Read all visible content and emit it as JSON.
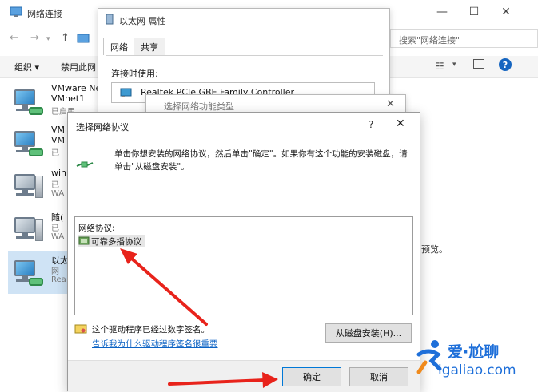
{
  "explorer": {
    "title": "网络连接",
    "window_controls": [
      "—",
      "☐",
      "✕"
    ],
    "nav": {
      "back": "←",
      "forward": "→",
      "up": "↑"
    },
    "search_placeholder": "搜索\"网络连接\"",
    "toolbar": {
      "organize": "组织 ▾",
      "disable": "禁用此网",
      "help": "?"
    },
    "preview_text": "预览。",
    "connections": [
      {
        "name": "VMware Ne",
        "line2": "VMnet1",
        "line3": "已启用"
      },
      {
        "name": "VM",
        "line2": "VM",
        "line3": "已"
      },
      {
        "name": "win",
        "line2": "已",
        "line3": "WA"
      },
      {
        "name": "随(",
        "line2": "已",
        "line3": "WA"
      },
      {
        "name": "以太",
        "line2": "网",
        "line3": "Rea"
      }
    ]
  },
  "props_dialog": {
    "title": "以太网 属性",
    "tabs": [
      "网络",
      "共享"
    ],
    "connect_using_label": "连接时使用:",
    "adapter": "Realtek PCIe GBE Family Controller",
    "close": "✕"
  },
  "feature_dialog": {
    "title": "选择网络功能类型",
    "close": "✕"
  },
  "protocol_dialog": {
    "title": "选择网络协议",
    "help": "?",
    "close": "✕",
    "instruction_line1": "单击你想安装的网络协议，然后单击\"确定\"。如果你有这个功能的安装磁盘，请",
    "instruction_line2": "单击\"从磁盘安装\"。",
    "list_label": "网络协议:",
    "protocols": [
      "可靠多播协议"
    ],
    "signed_text": "这个驱动程序已经过数字签名。",
    "signing_link": "告诉我为什么驱动程序签名很重要",
    "have_disk_button": "从磁盘安装(H)...",
    "ok_button": "确定",
    "cancel_button": "取消"
  },
  "watermark": {
    "brand": "爱·尬聊",
    "url": "igaliao.com"
  },
  "colors": {
    "accent": "#0078d7",
    "arrow": "#e8231b",
    "link": "#0b62c4",
    "watermark_blue": "#1e6fd9"
  }
}
